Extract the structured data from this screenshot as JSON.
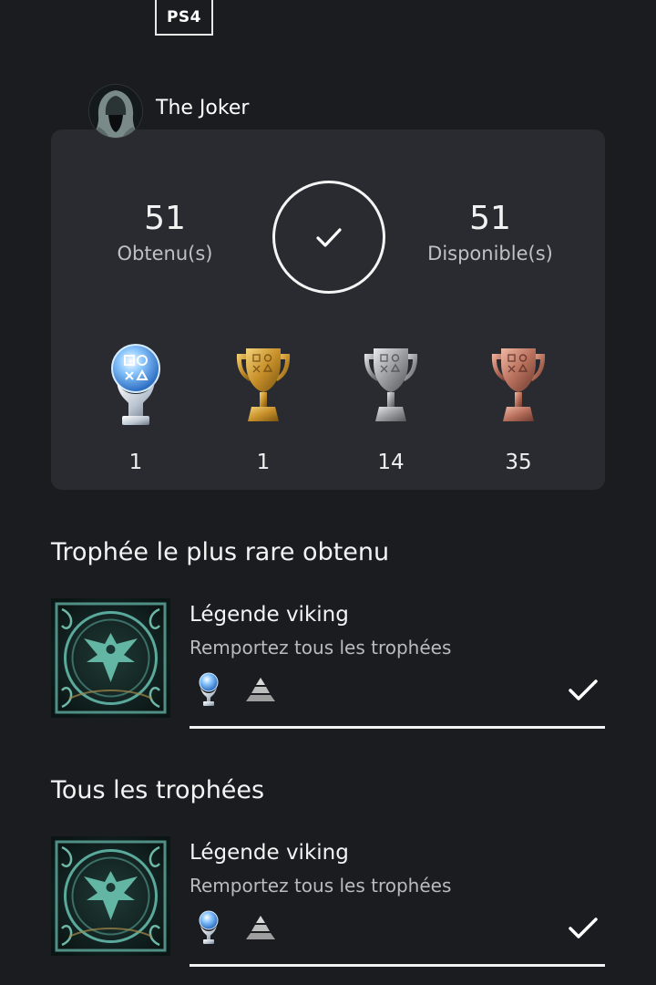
{
  "platform": "PS4",
  "profile": {
    "name": "The Joker"
  },
  "summary": {
    "earned_count": "51",
    "earned_label": "Obtenu(s)",
    "available_count": "51",
    "available_label": "Disponible(s)"
  },
  "trophy_counts": [
    {
      "type": "platinum",
      "count": "1"
    },
    {
      "type": "gold",
      "count": "1"
    },
    {
      "type": "silver",
      "count": "14"
    },
    {
      "type": "bronze",
      "count": "35"
    }
  ],
  "rarest": {
    "section_title": "Trophée le plus rare obtenu",
    "trophy": {
      "name": "Légende viking",
      "description": "Remportez tous les trophées",
      "grade": "platinum",
      "rarity_icon": "rarity-pyramid-icon",
      "earned": true
    }
  },
  "all_trophies": {
    "section_title": "Tous les trophées",
    "items": [
      {
        "name": "Légende viking",
        "description": "Remportez tous les trophées",
        "grade": "platinum",
        "rarity_icon": "rarity-pyramid-icon",
        "earned": true
      }
    ]
  },
  "colors": {
    "background": "#1b1c20",
    "card": "#292b31",
    "platinum": "#9fd0ff",
    "gold": "#d9a53a",
    "silver": "#b5b7ba",
    "bronze": "#c98a78"
  }
}
